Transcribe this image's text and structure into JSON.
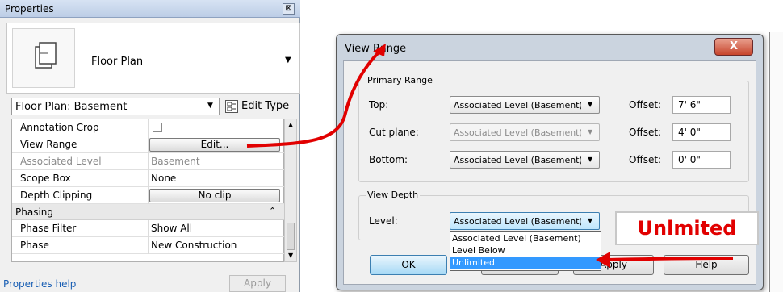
{
  "properties": {
    "title": "Properties",
    "close_glyph": "⊠",
    "type_name": "Floor Plan",
    "instance_selector": "Floor Plan: Basement",
    "edit_type_label": "Edit Type",
    "rows": [
      {
        "label": "Annotation Crop"
      },
      {
        "label": "View Range",
        "button": "Edit..."
      },
      {
        "label": "Associated Level",
        "value": "Basement"
      },
      {
        "label": "Scope Box",
        "value": "None"
      },
      {
        "label": "Depth Clipping",
        "button": "No clip"
      }
    ],
    "group_phasing": "Phasing",
    "phase_rows": [
      {
        "label": "Phase Filter",
        "value": "Show All"
      },
      {
        "label": "Phase",
        "value": "New Construction"
      }
    ],
    "help_link": "Properties help",
    "apply_label": "Apply"
  },
  "dialog": {
    "title": "View Range",
    "close_glyph": "X",
    "primary_range_label": "Primary Range",
    "rows": [
      {
        "label": "Top:",
        "level": "Associated Level (Basement)",
        "offset_label": "Offset:",
        "offset": "7'  6\""
      },
      {
        "label": "Cut plane:",
        "level": "Associated Level (Basement)",
        "offset_label": "Offset:",
        "offset": "4'  0\""
      },
      {
        "label": "Bottom:",
        "level": "Associated Level (Basement)",
        "offset_label": "Offset:",
        "offset": "0'  0\""
      }
    ],
    "view_depth_label": "View Depth",
    "level_label": "Level:",
    "level_value": "Associated Level (Basement)",
    "dropdown_options": [
      "Associated Level (Basement)",
      "Level Below",
      "Unlimited"
    ],
    "dropdown_selected": "Unlimited",
    "buttons": {
      "ok": "OK",
      "apply": "Apply",
      "help": "Help"
    }
  },
  "annotation": {
    "callout": "Unlmited"
  },
  "colors": {
    "arrow": "#e10000",
    "selection": "#3399ff",
    "callout_text": "#e10000"
  }
}
